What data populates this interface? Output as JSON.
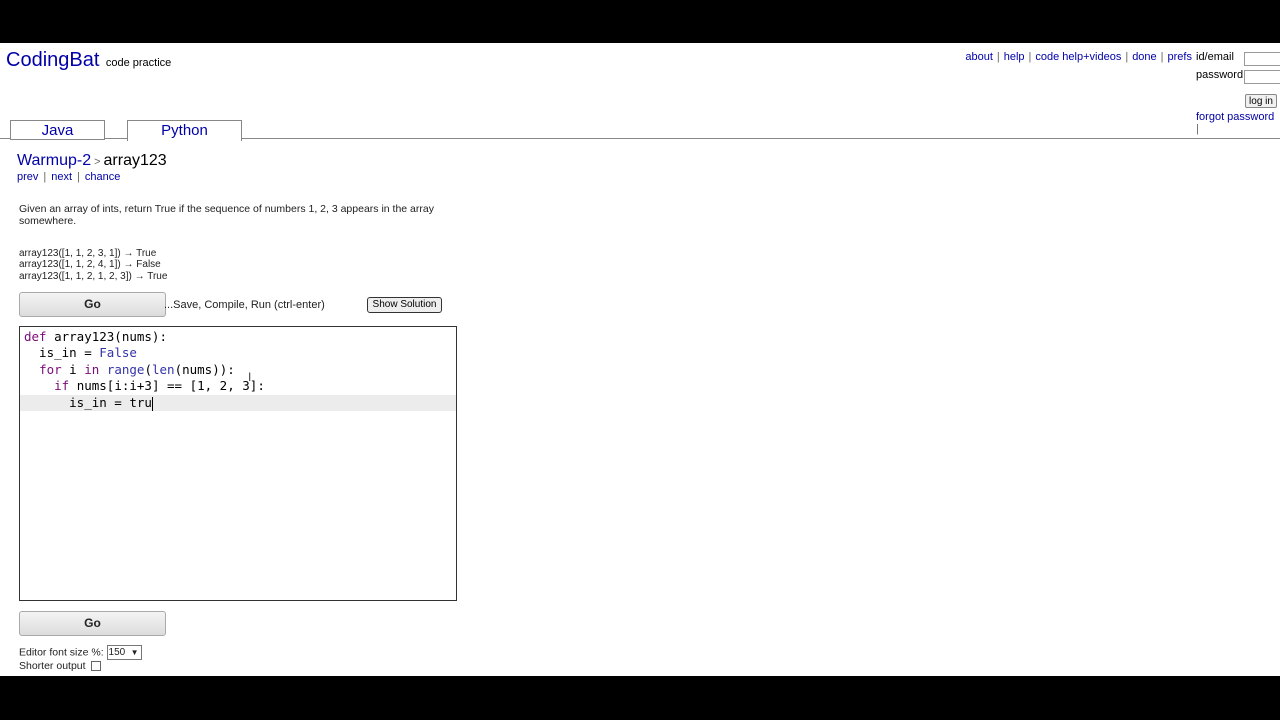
{
  "logo": {
    "main": "CodingBat",
    "sub": "code practice"
  },
  "topnav": [
    {
      "label": "about"
    },
    {
      "label": "help"
    },
    {
      "label": "code help+videos"
    },
    {
      "label": "done"
    },
    {
      "label": "prefs"
    }
  ],
  "login": {
    "id_label": "id/email",
    "password_label": "password",
    "button": "log in",
    "forgot": "forgot password",
    "forgot_sep": "|"
  },
  "tabs": [
    {
      "label": "Java",
      "active": false
    },
    {
      "label": "Python",
      "active": true
    }
  ],
  "breadcrumb": {
    "section": "Warmup-2",
    "arrow": ">",
    "problem": "array123"
  },
  "subnav": [
    "prev",
    "next",
    "chance"
  ],
  "description": "Given an array of ints, return True if the sequence of numbers 1, 2, 3 appears in the array somewhere.",
  "examples": [
    "array123([1, 1, 2, 3, 1]) → True",
    "array123([1, 1, 2, 4, 1]) → False",
    "array123([1, 1, 2, 1, 2, 3]) → True"
  ],
  "go_label": "Go",
  "save_text": "...Save, Compile, Run (ctrl-enter)",
  "show_solution": "Show Solution",
  "code": {
    "l1_kw": "def",
    "l1_rest": " array123(nums):",
    "l2_a": "  is_in = ",
    "l2_false": "False",
    "l3_for": "for",
    "l3_a": " i ",
    "l3_in": "in",
    "l3_b": " ",
    "l3_range": "range",
    "l3_c": "(",
    "l3_len": "len",
    "l3_d": "(nums)):",
    "l4_if": "if",
    "l4_rest": " nums[i:i+3] == [1, 2, 3]:",
    "l5": "      is_in = tru"
  },
  "editor_font": {
    "label": "Editor font size %:",
    "value": "150"
  },
  "shorter_output": {
    "label": "Shorter output",
    "checked": false
  }
}
